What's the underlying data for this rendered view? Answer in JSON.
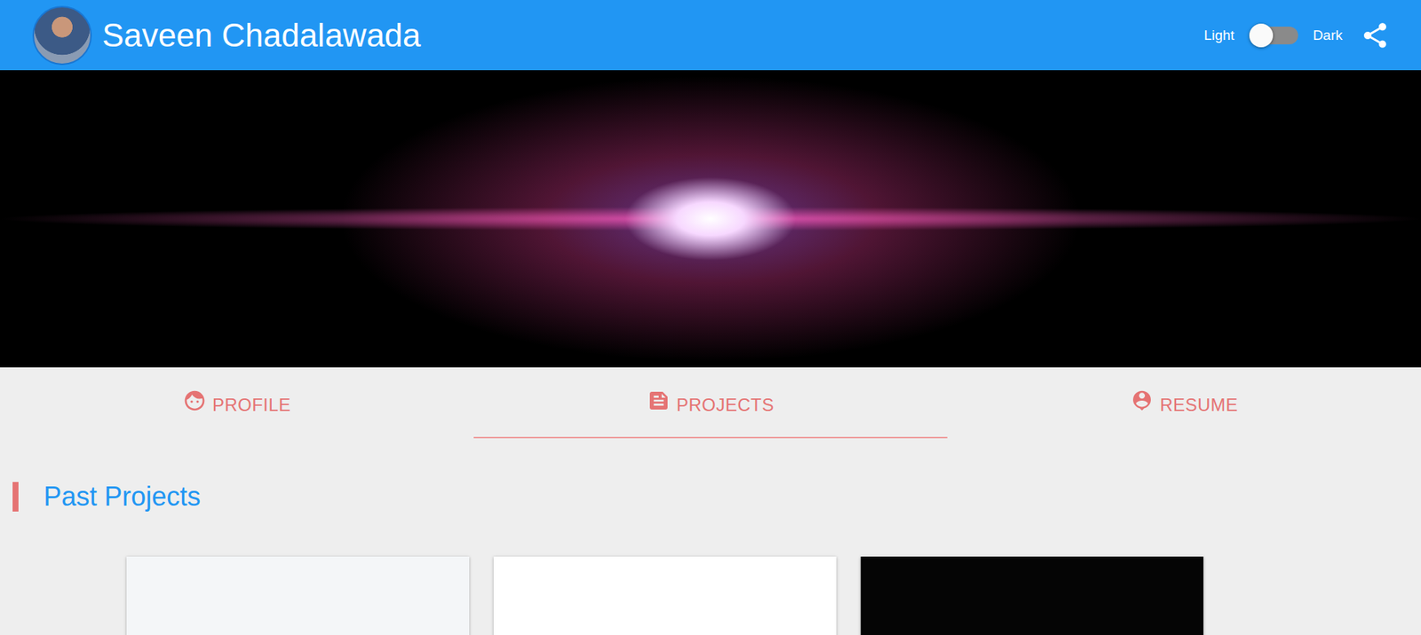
{
  "header": {
    "title": "Saveen Chadalawada",
    "theme_toggle": {
      "left_label": "Light",
      "right_label": "Dark",
      "on": false
    }
  },
  "tabs": [
    {
      "label": "PROFILE",
      "selected": false
    },
    {
      "label": "PROJECTS",
      "selected": true
    },
    {
      "label": "RESUME",
      "selected": false
    }
  ],
  "section": {
    "title": "Past Projects"
  },
  "projects": [
    {
      "color": "#f4f6f8"
    },
    {
      "color": "#ffffff"
    },
    {
      "color": "#050505"
    }
  ]
}
